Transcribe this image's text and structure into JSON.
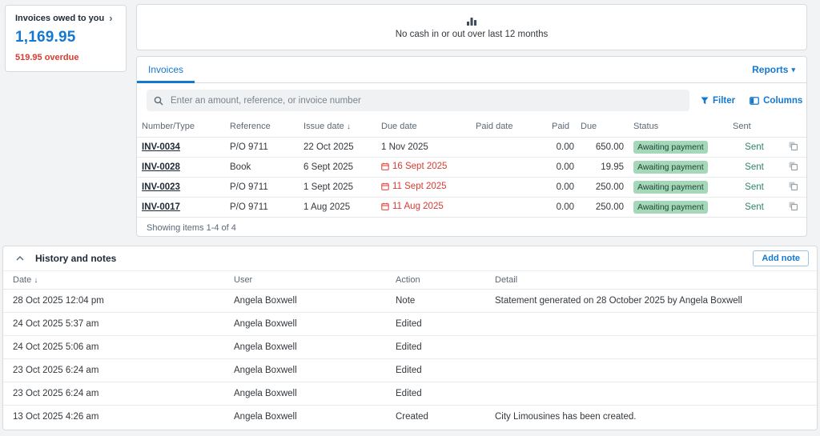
{
  "icons": {
    "chevron_right": "›",
    "dropdown_arrow": "▾",
    "sort_down": "↓"
  },
  "summary_card": {
    "title": "Invoices owed to you",
    "amount": "1,169.95",
    "overdue": "519.95 overdue"
  },
  "cash_panel": {
    "message": "No cash in or out over last 12 months"
  },
  "invoices_panel": {
    "tab_label": "Invoices",
    "reports_label": "Reports",
    "search_placeholder": "Enter an amount, reference, or invoice number",
    "filter_label": "Filter",
    "columns_label": "Columns",
    "columns": [
      "Number/Type",
      "Reference",
      "Issue date",
      "Due date",
      "Paid date",
      "Paid",
      "Due",
      "Status",
      "Sent"
    ],
    "rows": [
      {
        "number": "INV-0034",
        "reference": "P/O 9711",
        "issue_date": "22 Oct 2025",
        "due_date": "1 Nov 2025",
        "due_overdue": false,
        "paid_date": "",
        "paid": "0.00",
        "due": "650.00",
        "status": "Awaiting payment",
        "sent": "Sent"
      },
      {
        "number": "INV-0028",
        "reference": "Book",
        "issue_date": "6 Sept 2025",
        "due_date": "16 Sept 2025",
        "due_overdue": true,
        "paid_date": "",
        "paid": "0.00",
        "due": "19.95",
        "status": "Awaiting payment",
        "sent": "Sent"
      },
      {
        "number": "INV-0023",
        "reference": "P/O 9711",
        "issue_date": "1 Sept 2025",
        "due_date": "11 Sept 2025",
        "due_overdue": true,
        "paid_date": "",
        "paid": "0.00",
        "due": "250.00",
        "status": "Awaiting payment",
        "sent": "Sent"
      },
      {
        "number": "INV-0017",
        "reference": "P/O 9711",
        "issue_date": "1 Aug 2025",
        "due_date": "11 Aug 2025",
        "due_overdue": true,
        "paid_date": "",
        "paid": "0.00",
        "due": "250.00",
        "status": "Awaiting payment",
        "sent": "Sent"
      }
    ],
    "footer": "Showing items 1-4 of 4"
  },
  "history_panel": {
    "title": "History and notes",
    "add_note_label": "Add note",
    "columns": [
      "Date",
      "User",
      "Action",
      "Detail"
    ],
    "rows": [
      {
        "date": "28 Oct 2025 12:04 pm",
        "user": "Angela Boxwell",
        "action": "Note",
        "detail": "Statement generated on 28 October 2025 by Angela Boxwell"
      },
      {
        "date": "24 Oct 2025 5:37 am",
        "user": "Angela Boxwell",
        "action": "Edited",
        "detail": ""
      },
      {
        "date": "24 Oct 2025 5:06 am",
        "user": "Angela Boxwell",
        "action": "Edited",
        "detail": ""
      },
      {
        "date": "23 Oct 2025 6:24 am",
        "user": "Angela Boxwell",
        "action": "Edited",
        "detail": ""
      },
      {
        "date": "23 Oct 2025 6:24 am",
        "user": "Angela Boxwell",
        "action": "Edited",
        "detail": ""
      },
      {
        "date": "13 Oct 2025 4:26 am",
        "user": "Angela Boxwell",
        "action": "Created",
        "detail": "City Limousines has been created."
      }
    ]
  },
  "colors": {
    "accent_blue": "#1378d1",
    "alert_red": "#d93b30",
    "sent_green": "#2e8566",
    "badge_green_bg": "#a5d8b8"
  }
}
